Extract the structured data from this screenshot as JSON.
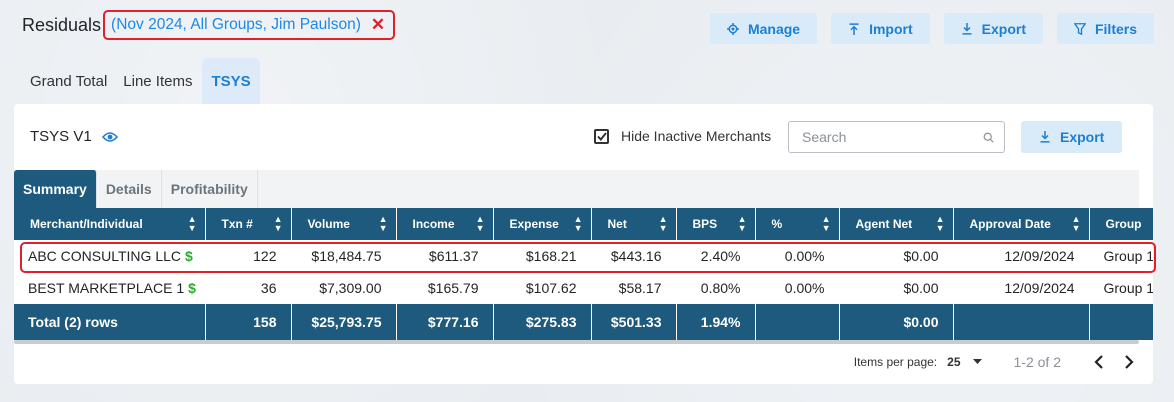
{
  "header": {
    "title": "Residuals",
    "filter_text": "(Nov 2024, All Groups, Jim Paulson)",
    "filter_close": "✕"
  },
  "actions": {
    "manage": "Manage",
    "import": "Import",
    "export": "Export",
    "filters": "Filters"
  },
  "tabs": [
    "Grand Total",
    "Line Items",
    "TSYS"
  ],
  "active_tab": "TSYS",
  "card": {
    "title": "TSYS V1",
    "hide_inactive_label": "Hide Inactive Merchants",
    "hide_inactive_checked": true,
    "search_placeholder": "Search",
    "export_label": "Export"
  },
  "subtabs": [
    "Summary",
    "Details",
    "Profitability"
  ],
  "active_subtab": "Summary",
  "table": {
    "columns": [
      "Merchant/Individual",
      "Txn #",
      "Volume",
      "Income",
      "Expense",
      "Net",
      "BPS",
      "%",
      "Agent Net",
      "Approval Date",
      "Group"
    ],
    "rows": [
      [
        "ABC CONSULTING LLC",
        "122",
        "$18,484.75",
        "$611.37",
        "$168.21",
        "$443.16",
        "2.40%",
        "0.00%",
        "$0.00",
        "12/09/2024",
        "Group 1"
      ],
      [
        "BEST MARKETPLACE 1",
        "36",
        "$7,309.00",
        "$165.79",
        "$107.62",
        "$58.17",
        "0.80%",
        "0.00%",
        "$0.00",
        "12/09/2024",
        "Group 1"
      ]
    ],
    "total": [
      "Total (2) rows",
      "158",
      "$25,793.75",
      "$777.16",
      "$275.83",
      "$501.33",
      "1.94%",
      "",
      "$0.00",
      "",
      ""
    ],
    "merchant_marker": "$"
  },
  "pager": {
    "items_per_page_label": "Items per page:",
    "items_per_page": "25",
    "range": "1-2 of 2"
  },
  "colors": {
    "accent": "#1c7fd4",
    "header_bg": "#1d5a7d",
    "highlight": "#e0202a",
    "dollar_icon": "#2eaa2e"
  }
}
